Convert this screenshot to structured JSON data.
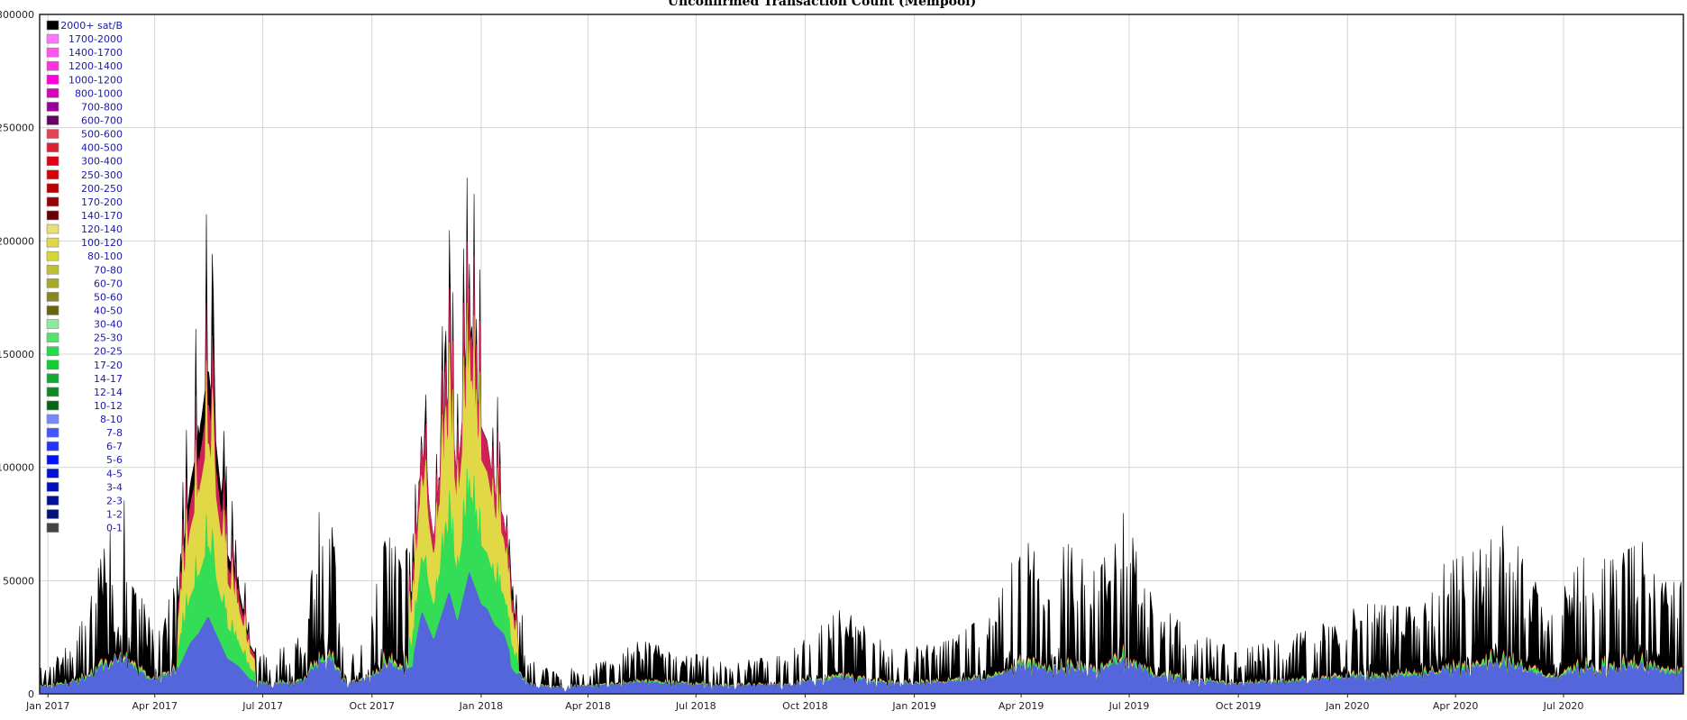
{
  "chart_data": {
    "type": "area",
    "title": "Unconfirmed Transaction Count (Mempool)",
    "xlabel": "",
    "ylabel": "",
    "x_range": [
      "2016-12-25",
      "2020-10-10"
    ],
    "ylim": [
      0,
      300000
    ],
    "y_ticks": [
      0,
      50000,
      100000,
      150000,
      200000,
      250000,
      300000
    ],
    "x_ticks": [
      {
        "date": "2017-01-01",
        "label": "Jan 2017"
      },
      {
        "date": "2017-04-01",
        "label": "Apr 2017"
      },
      {
        "date": "2017-07-01",
        "label": "Jul 2017"
      },
      {
        "date": "2017-10-01",
        "label": "Oct 2017"
      },
      {
        "date": "2018-01-01",
        "label": "Jan 2018"
      },
      {
        "date": "2018-04-01",
        "label": "Apr 2018"
      },
      {
        "date": "2018-07-01",
        "label": "Jul 2018"
      },
      {
        "date": "2018-10-01",
        "label": "Oct 2018"
      },
      {
        "date": "2019-01-01",
        "label": "Jan 2019"
      },
      {
        "date": "2019-04-01",
        "label": "Apr 2019"
      },
      {
        "date": "2019-07-01",
        "label": "Jul 2019"
      },
      {
        "date": "2019-10-01",
        "label": "Oct 2019"
      },
      {
        "date": "2020-01-01",
        "label": "Jan 2020"
      },
      {
        "date": "2020-04-01",
        "label": "Apr 2020"
      },
      {
        "date": "2020-07-01",
        "label": "Jul 2020"
      }
    ],
    "grid": true,
    "legend_position": "top-left",
    "legend": [
      {
        "name": "2000+ sat/B",
        "color": "#000000"
      },
      {
        "name": "1700-2000",
        "color": "#ff77ff"
      },
      {
        "name": "1400-1700",
        "color": "#ff55ee"
      },
      {
        "name": "1200-1400",
        "color": "#ff33dd"
      },
      {
        "name": "1000-1200",
        "color": "#ff00dd"
      },
      {
        "name": "800-1000",
        "color": "#dd00bb"
      },
      {
        "name": "700-800",
        "color": "#990099"
      },
      {
        "name": "600-700",
        "color": "#660066"
      },
      {
        "name": "500-600",
        "color": "#e04455"
      },
      {
        "name": "400-500",
        "color": "#dd2233"
      },
      {
        "name": "300-400",
        "color": "#dd0011"
      },
      {
        "name": "250-300",
        "color": "#dd0000"
      },
      {
        "name": "200-250",
        "color": "#bb0000"
      },
      {
        "name": "170-200",
        "color": "#990000"
      },
      {
        "name": "140-170",
        "color": "#660000"
      },
      {
        "name": "120-140",
        "color": "#e8e077"
      },
      {
        "name": "100-120",
        "color": "#e0d844"
      },
      {
        "name": "80-100",
        "color": "#d8d833"
      },
      {
        "name": "70-80",
        "color": "#c0c033"
      },
      {
        "name": "60-70",
        "color": "#a8a830"
      },
      {
        "name": "50-60",
        "color": "#888820"
      },
      {
        "name": "40-50",
        "color": "#666611"
      },
      {
        "name": "30-40",
        "color": "#88ee99"
      },
      {
        "name": "25-30",
        "color": "#55e070"
      },
      {
        "name": "20-25",
        "color": "#22dd44"
      },
      {
        "name": "17-20",
        "color": "#11cc33"
      },
      {
        "name": "14-17",
        "color": "#11aa33"
      },
      {
        "name": "12-14",
        "color": "#118822"
      },
      {
        "name": "10-12",
        "color": "#006611"
      },
      {
        "name": "8-10",
        "color": "#7788ff"
      },
      {
        "name": "7-8",
        "color": "#4455ff"
      },
      {
        "name": "6-7",
        "color": "#2233ff"
      },
      {
        "name": "5-6",
        "color": "#0011ff"
      },
      {
        "name": "4-5",
        "color": "#0011dd"
      },
      {
        "name": "3-4",
        "color": "#0011bb"
      },
      {
        "name": "2-3",
        "color": "#001199"
      },
      {
        "name": "1-2",
        "color": "#001177"
      },
      {
        "name": "0-1",
        "color": "#444444"
      }
    ],
    "series_outline": {
      "total_color": "#000000",
      "high_fee_color": "#cc2255",
      "mid_fee_color": "#e0d844",
      "low_fee_color": "#33dd55",
      "base_fee_color": "#5566dd"
    },
    "total_peaks": [
      {
        "date": "2017-01-01",
        "value": 12000
      },
      {
        "date": "2017-01-10",
        "value": 18000
      },
      {
        "date": "2017-01-22",
        "value": 25000
      },
      {
        "date": "2017-02-04",
        "value": 40000
      },
      {
        "date": "2017-02-14",
        "value": 62000
      },
      {
        "date": "2017-02-22",
        "value": 75000
      },
      {
        "date": "2017-03-02",
        "value": 97000
      },
      {
        "date": "2017-03-12",
        "value": 80000
      },
      {
        "date": "2017-03-25",
        "value": 35000
      },
      {
        "date": "2017-04-08",
        "value": 40000
      },
      {
        "date": "2017-04-20",
        "value": 60000
      },
      {
        "date": "2017-05-01",
        "value": 150000
      },
      {
        "date": "2017-05-08",
        "value": 180000
      },
      {
        "date": "2017-05-16",
        "value": 233000
      },
      {
        "date": "2017-05-22",
        "value": 183000
      },
      {
        "date": "2017-06-01",
        "value": 100000
      },
      {
        "date": "2017-06-10",
        "value": 78000
      },
      {
        "date": "2017-06-20",
        "value": 35000
      },
      {
        "date": "2017-07-01",
        "value": 18000
      },
      {
        "date": "2017-07-20",
        "value": 22000
      },
      {
        "date": "2017-08-05",
        "value": 28000
      },
      {
        "date": "2017-08-20",
        "value": 96000
      },
      {
        "date": "2017-08-26",
        "value": 88000
      },
      {
        "date": "2017-09-10",
        "value": 20000
      },
      {
        "date": "2017-10-01",
        "value": 40000
      },
      {
        "date": "2017-10-15",
        "value": 80000
      },
      {
        "date": "2017-10-25",
        "value": 60000
      },
      {
        "date": "2017-11-05",
        "value": 75000
      },
      {
        "date": "2017-11-12",
        "value": 175000
      },
      {
        "date": "2017-11-22",
        "value": 110000
      },
      {
        "date": "2017-12-05",
        "value": 218000
      },
      {
        "date": "2017-12-12",
        "value": 150000
      },
      {
        "date": "2017-12-22",
        "value": 261000
      },
      {
        "date": "2018-01-01",
        "value": 190000
      },
      {
        "date": "2018-01-06",
        "value": 180000
      },
      {
        "date": "2018-01-12",
        "value": 145000
      },
      {
        "date": "2018-01-20",
        "value": 125000
      },
      {
        "date": "2018-01-28",
        "value": 60000
      },
      {
        "date": "2018-02-10",
        "value": 20000
      },
      {
        "date": "2018-03-01",
        "value": 10000
      },
      {
        "date": "2018-04-15",
        "value": 15000
      },
      {
        "date": "2018-05-15",
        "value": 25000
      },
      {
        "date": "2018-06-15",
        "value": 20000
      },
      {
        "date": "2018-08-01",
        "value": 15000
      },
      {
        "date": "2018-09-15",
        "value": 18000
      },
      {
        "date": "2018-11-01",
        "value": 40000
      },
      {
        "date": "2018-12-15",
        "value": 20000
      },
      {
        "date": "2019-02-01",
        "value": 25000
      },
      {
        "date": "2019-03-10",
        "value": 40000
      },
      {
        "date": "2019-04-02",
        "value": 74000
      },
      {
        "date": "2019-04-20",
        "value": 60000
      },
      {
        "date": "2019-05-10",
        "value": 70000
      },
      {
        "date": "2019-06-05",
        "value": 55000
      },
      {
        "date": "2019-06-28",
        "value": 92000
      },
      {
        "date": "2019-07-20",
        "value": 45000
      },
      {
        "date": "2019-08-20",
        "value": 30000
      },
      {
        "date": "2019-10-01",
        "value": 20000
      },
      {
        "date": "2019-12-01",
        "value": 30000
      },
      {
        "date": "2020-01-15",
        "value": 42000
      },
      {
        "date": "2020-03-01",
        "value": 40000
      },
      {
        "date": "2020-03-20",
        "value": 60000
      },
      {
        "date": "2020-04-25",
        "value": 68000
      },
      {
        "date": "2020-05-15",
        "value": 81000
      },
      {
        "date": "2020-05-28",
        "value": 62000
      },
      {
        "date": "2020-06-20",
        "value": 40000
      },
      {
        "date": "2020-07-20",
        "value": 65000
      },
      {
        "date": "2020-08-10",
        "value": 62000
      },
      {
        "date": "2020-09-05",
        "value": 71000
      },
      {
        "date": "2020-09-25",
        "value": 52000
      }
    ]
  }
}
